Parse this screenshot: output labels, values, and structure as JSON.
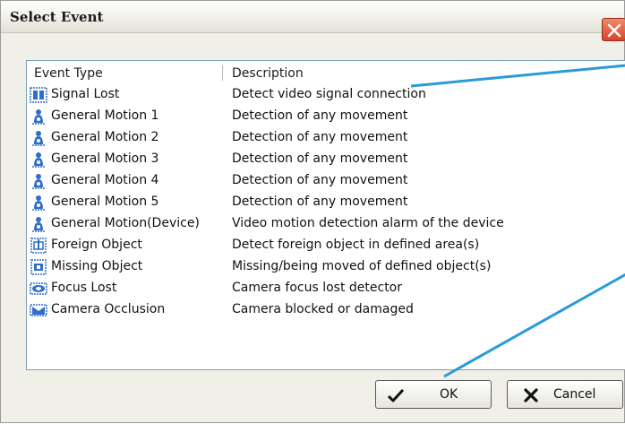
{
  "window": {
    "title": "Select Event"
  },
  "list": {
    "columns": [
      "Event Type",
      "Description"
    ],
    "rows": [
      {
        "icon": "signal-lost-icon",
        "type": "Signal Lost",
        "description": "Detect video signal connection"
      },
      {
        "icon": "motion-icon",
        "type": "General Motion 1",
        "description": "Detection of any movement"
      },
      {
        "icon": "motion-icon",
        "type": "General Motion 2",
        "description": "Detection of any movement"
      },
      {
        "icon": "motion-icon",
        "type": "General Motion 3",
        "description": "Detection of any movement"
      },
      {
        "icon": "motion-icon",
        "type": "General Motion 4",
        "description": "Detection of any movement"
      },
      {
        "icon": "motion-icon",
        "type": "General Motion 5",
        "description": "Detection of any movement"
      },
      {
        "icon": "motion-icon",
        "type": "General Motion(Device)",
        "description": "Video motion detection alarm of the device"
      },
      {
        "icon": "foreign-object-icon",
        "type": "Foreign Object",
        "description": "Detect foreign object in defined area(s)"
      },
      {
        "icon": "missing-object-icon",
        "type": "Missing Object",
        "description": "Missing/being moved of defined object(s)"
      },
      {
        "icon": "focus-lost-icon",
        "type": "Focus Lost",
        "description": "Camera focus lost detector"
      },
      {
        "icon": "occlusion-icon",
        "type": "Camera Occlusion",
        "description": "Camera blocked or damaged"
      }
    ]
  },
  "buttons": {
    "ok": "OK",
    "cancel": "Cancel"
  },
  "colors": {
    "callout": "#2a9ad8",
    "close": "#d8452a"
  }
}
